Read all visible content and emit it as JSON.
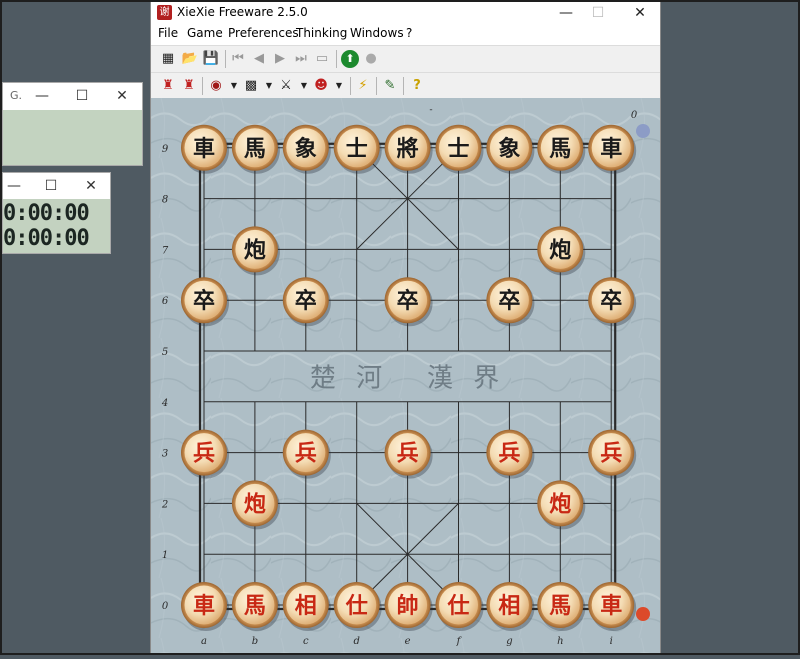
{
  "bg_window_1": {
    "title": "G.",
    "controls": [
      "—",
      "☐",
      "✕"
    ]
  },
  "bg_window_2": {
    "controls": [
      "—",
      "☐",
      "✕"
    ],
    "clock_top": "0:00:00",
    "clock_bottom": "0:00:00"
  },
  "window": {
    "title": "XieXie Freeware 2.5.0",
    "icon_glyph": "谢",
    "controls": {
      "minimize": "—",
      "maximize": "☐",
      "close": "✕"
    }
  },
  "menu": [
    "File",
    "Game",
    "Preferences",
    "Thinking",
    "Windows",
    "?"
  ],
  "toolbar1": [
    {
      "name": "grid-icon",
      "glyph": "▦"
    },
    {
      "name": "open-icon",
      "glyph": "📂"
    },
    {
      "name": "save-icon",
      "glyph": "💾"
    },
    {
      "name": "first-move-icon",
      "glyph": "⏮"
    },
    {
      "name": "previous-move-icon",
      "glyph": "◀"
    },
    {
      "name": "next-move-icon",
      "glyph": "▶"
    },
    {
      "name": "last-move-icon",
      "glyph": "⏭"
    },
    {
      "name": "monitor-icon",
      "glyph": "▭"
    },
    {
      "name": "start-engine-icon",
      "glyph": "⬆"
    },
    {
      "name": "stop-engine-icon",
      "glyph": "●"
    }
  ],
  "toolbar2": [
    {
      "name": "new-game-red-icon",
      "glyph": "♜"
    },
    {
      "name": "new-game-black-icon",
      "glyph": "♜"
    },
    {
      "name": "piece-style-icon",
      "glyph": "◉"
    },
    {
      "name": "board-style-icon",
      "glyph": "▩"
    },
    {
      "name": "figure-icon",
      "glyph": "⚔"
    },
    {
      "name": "tongue-icon",
      "glyph": "☻"
    },
    {
      "name": "lightning-icon",
      "glyph": "⚡"
    },
    {
      "name": "edit-board-icon",
      "glyph": "✎"
    },
    {
      "name": "hint-icon",
      "glyph": "?"
    }
  ],
  "colors": {
    "board_bg": "#aebec6",
    "line": "#2a2a2a",
    "piece_face": "#f4dcb4",
    "piece_rim": "#d59a5a",
    "black_text": "#1a1a1a",
    "red_text": "#c82814",
    "indicator_black": "#8c9cc6",
    "indicator_red": "#dc4a2a"
  },
  "board": {
    "files": [
      "a",
      "b",
      "c",
      "d",
      "e",
      "f",
      "g",
      "h",
      "i"
    ],
    "ranks": [
      "0",
      "1",
      "2",
      "3",
      "4",
      "5",
      "6",
      "7",
      "8",
      "9"
    ],
    "river_left": "楚 河",
    "river_right": "漢 界",
    "move_counter": "0",
    "top_mark": "-"
  },
  "pieces": [
    {
      "ch": "車",
      "color": "black",
      "file": 0,
      "rank": 9
    },
    {
      "ch": "馬",
      "color": "black",
      "file": 1,
      "rank": 9
    },
    {
      "ch": "象",
      "color": "black",
      "file": 2,
      "rank": 9
    },
    {
      "ch": "士",
      "color": "black",
      "file": 3,
      "rank": 9
    },
    {
      "ch": "將",
      "color": "black",
      "file": 4,
      "rank": 9
    },
    {
      "ch": "士",
      "color": "black",
      "file": 5,
      "rank": 9
    },
    {
      "ch": "象",
      "color": "black",
      "file": 6,
      "rank": 9
    },
    {
      "ch": "馬",
      "color": "black",
      "file": 7,
      "rank": 9
    },
    {
      "ch": "車",
      "color": "black",
      "file": 8,
      "rank": 9
    },
    {
      "ch": "炮",
      "color": "black",
      "file": 1,
      "rank": 7
    },
    {
      "ch": "炮",
      "color": "black",
      "file": 7,
      "rank": 7
    },
    {
      "ch": "卒",
      "color": "black",
      "file": 0,
      "rank": 6
    },
    {
      "ch": "卒",
      "color": "black",
      "file": 2,
      "rank": 6
    },
    {
      "ch": "卒",
      "color": "black",
      "file": 4,
      "rank": 6
    },
    {
      "ch": "卒",
      "color": "black",
      "file": 6,
      "rank": 6
    },
    {
      "ch": "卒",
      "color": "black",
      "file": 8,
      "rank": 6
    },
    {
      "ch": "兵",
      "color": "red",
      "file": 0,
      "rank": 3
    },
    {
      "ch": "兵",
      "color": "red",
      "file": 2,
      "rank": 3
    },
    {
      "ch": "兵",
      "color": "red",
      "file": 4,
      "rank": 3
    },
    {
      "ch": "兵",
      "color": "red",
      "file": 6,
      "rank": 3
    },
    {
      "ch": "兵",
      "color": "red",
      "file": 8,
      "rank": 3
    },
    {
      "ch": "炮",
      "color": "red",
      "file": 1,
      "rank": 2
    },
    {
      "ch": "炮",
      "color": "red",
      "file": 7,
      "rank": 2
    },
    {
      "ch": "車",
      "color": "red",
      "file": 0,
      "rank": 0
    },
    {
      "ch": "馬",
      "color": "red",
      "file": 1,
      "rank": 0
    },
    {
      "ch": "相",
      "color": "red",
      "file": 2,
      "rank": 0
    },
    {
      "ch": "仕",
      "color": "red",
      "file": 3,
      "rank": 0
    },
    {
      "ch": "帥",
      "color": "red",
      "file": 4,
      "rank": 0
    },
    {
      "ch": "仕",
      "color": "red",
      "file": 5,
      "rank": 0
    },
    {
      "ch": "相",
      "color": "red",
      "file": 6,
      "rank": 0
    },
    {
      "ch": "馬",
      "color": "red",
      "file": 7,
      "rank": 0
    },
    {
      "ch": "車",
      "color": "red",
      "file": 8,
      "rank": 0
    }
  ]
}
